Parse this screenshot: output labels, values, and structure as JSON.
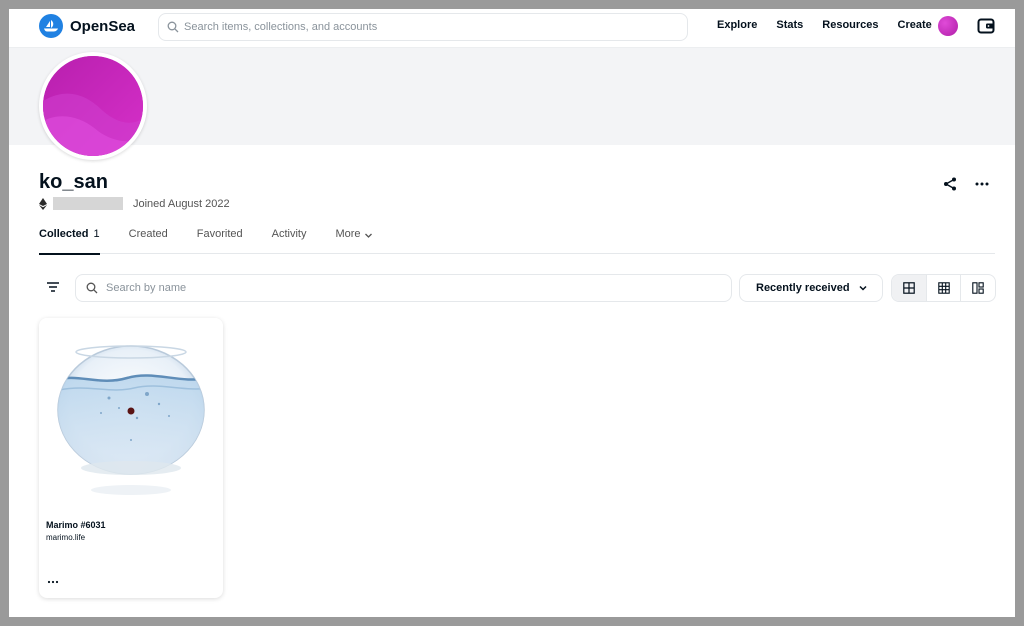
{
  "header": {
    "brand": "OpenSea",
    "search_placeholder": "Search items, collections, and accounts",
    "nav": [
      "Explore",
      "Stats",
      "Resources",
      "Create"
    ],
    "icons": {
      "logo": "opensea-logo-icon",
      "search": "search-icon",
      "wallet": "wallet-icon"
    }
  },
  "profile": {
    "username": "ko_san",
    "joined": "Joined August 2022",
    "icons": {
      "chain": "ethereum-icon",
      "share": "share-icon",
      "more": "more-options-icon"
    }
  },
  "tabs": [
    {
      "label": "Collected",
      "count": "1",
      "active": true
    },
    {
      "label": "Created"
    },
    {
      "label": "Favorited"
    },
    {
      "label": "Activity"
    },
    {
      "label": "More"
    }
  ],
  "toolbar": {
    "search_placeholder": "Search by name",
    "sort_selected": "Recently received",
    "view_modes": [
      "large-grid-icon",
      "small-grid-icon",
      "mosaic-icon"
    ]
  },
  "items": [
    {
      "name": "Marimo #6031",
      "collection": "marimo.life"
    }
  ],
  "colors": {
    "brand": "#2081e2",
    "avatar": "#c026b8",
    "text": "#04111d"
  }
}
